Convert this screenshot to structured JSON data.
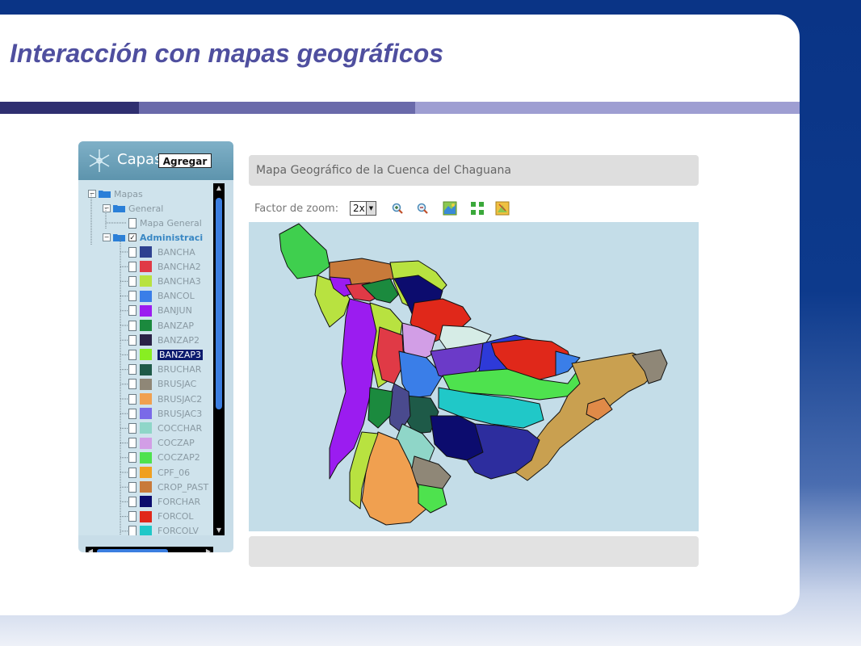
{
  "slide": {
    "title": "Interacción con mapas geográficos",
    "bar_colors": [
      "#2f2f70",
      "#6a6aaa",
      "#9e9ed2"
    ]
  },
  "layers_panel": {
    "title": "Capas",
    "add_button": "Agregar",
    "tree": {
      "root": "Mapas",
      "general": "General",
      "general_map": "Mapa General",
      "admin": "Administraci",
      "admin_checked": "✓"
    },
    "layers": [
      {
        "name": "BANCHA",
        "color": "#2e4190"
      },
      {
        "name": "BANCHA2",
        "color": "#e03a46"
      },
      {
        "name": "BANCHA3",
        "color": "#b8e240"
      },
      {
        "name": "BANCOL",
        "color": "#3a7ee8"
      },
      {
        "name": "BANJUN",
        "color": "#9b1cf0"
      },
      {
        "name": "BANZAP",
        "color": "#1b8a3e"
      },
      {
        "name": "BANZAP2",
        "color": "#2a2246"
      },
      {
        "name": "BANZAP3",
        "color": "#88ee22"
      },
      {
        "name": "BRUCHAR",
        "color": "#1e5a48"
      },
      {
        "name": "BRUSJAC",
        "color": "#8f8777"
      },
      {
        "name": "BRUSJAC2",
        "color": "#f0a050"
      },
      {
        "name": "BRUSJAC3",
        "color": "#7a6ae8"
      },
      {
        "name": "COCCHAR",
        "color": "#8fd6c8"
      },
      {
        "name": "COCZAP",
        "color": "#d29ee6"
      },
      {
        "name": "COCZAP2",
        "color": "#4ee24e"
      },
      {
        "name": "CPF_06",
        "color": "#f0a020"
      },
      {
        "name": "CROP_PAST",
        "color": "#c87a3a"
      },
      {
        "name": "FORCHAR",
        "color": "#0c0c6e"
      },
      {
        "name": "FORCOL",
        "color": "#e0281a"
      },
      {
        "name": "FORCOLV",
        "color": "#20c8c8"
      }
    ],
    "selected_layer": "BANZAP3"
  },
  "map": {
    "title": "Mapa Geográfico de la Cuenca del Chaguana",
    "zoom_label": "Factor de zoom:",
    "zoom_value": "2x",
    "tools": [
      "zoom-in-icon",
      "zoom-out-icon",
      "map-image-icon",
      "full-extent-icon",
      "map-export-icon"
    ],
    "background_color": "#c4dde8"
  }
}
